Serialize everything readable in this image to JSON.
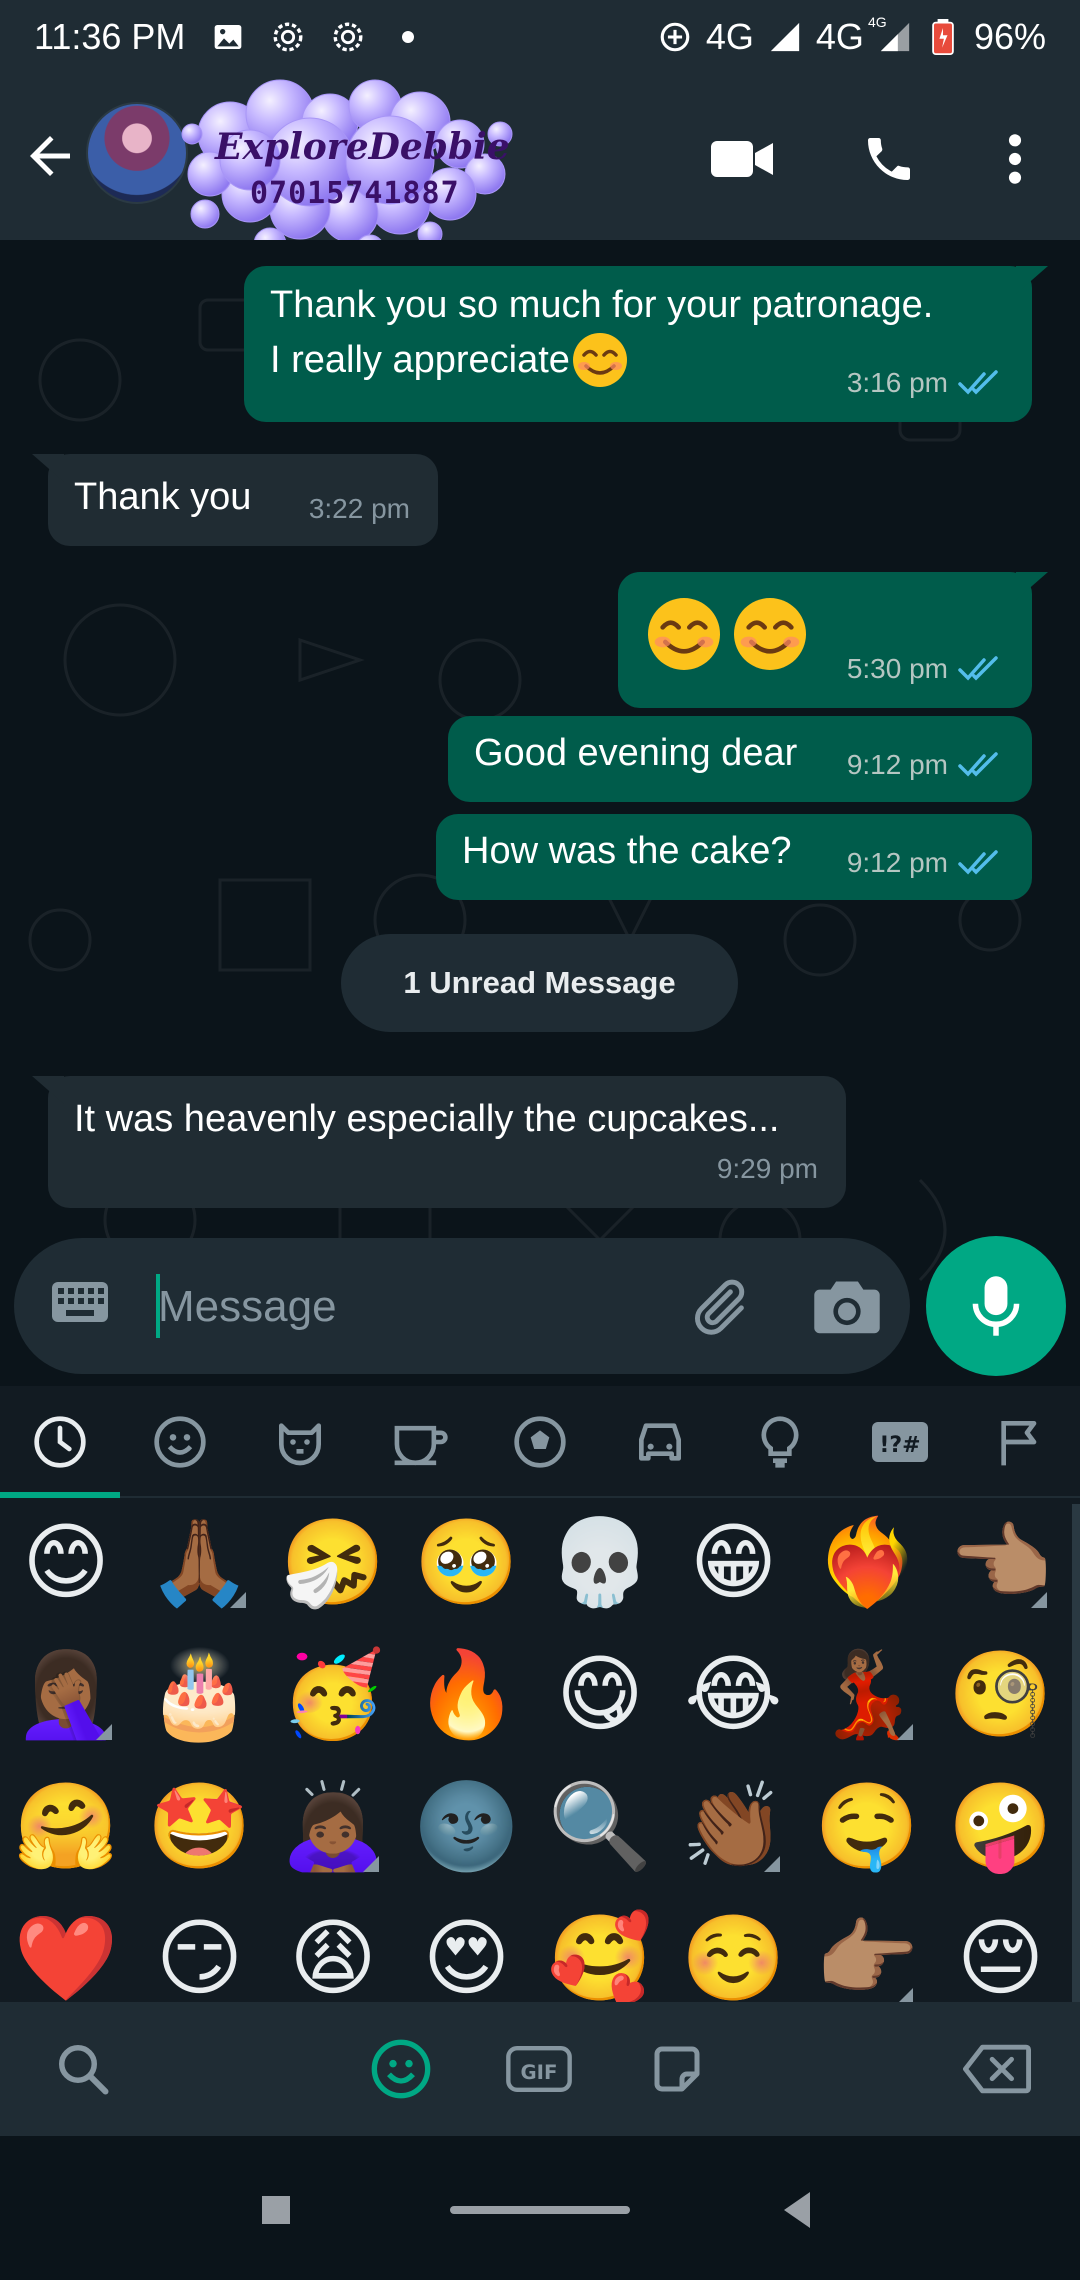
{
  "status_bar": {
    "time": "11:36 PM",
    "network_1": "4G",
    "network_2": "4G",
    "network_2_sup": "4G",
    "battery": "96%"
  },
  "header": {
    "contact_name": "ExploreDebbie",
    "contact_phone": "07015741887"
  },
  "messages": [
    {
      "direction": "out",
      "text_line1": "Thank you so much for your patronage.",
      "text_line2": "I really appreciate",
      "emoji": "smiling-face-with-smiling-eyes",
      "time": "3:16 pm",
      "status": "read"
    },
    {
      "direction": "in",
      "text": "Thank you",
      "time": "3:22 pm"
    },
    {
      "direction": "out",
      "emoji": [
        "smiling-face-with-smiling-eyes",
        "smiling-face-with-smiling-eyes"
      ],
      "time": "5:30 pm",
      "status": "read"
    },
    {
      "direction": "out",
      "text": "Good evening dear",
      "time": "9:12 pm",
      "status": "read"
    },
    {
      "direction": "out",
      "text": "How was the cake?",
      "time": "9:12 pm",
      "status": "read"
    },
    {
      "direction": "in",
      "text": "It was heavenly especially the cupcakes...",
      "time": "9:29 pm"
    }
  ],
  "unread_divider": "1 Unread Message",
  "composer": {
    "placeholder": "Message"
  },
  "emoji_categories": [
    "recent-icon",
    "smileys-icon",
    "animals-icon",
    "food-icon",
    "activity-icon",
    "travel-icon",
    "objects-icon",
    "symbols-icon",
    "flags-icon"
  ],
  "emoji_grid": [
    [
      "😊",
      "🙏🏾",
      "🤧",
      "🥹",
      "💀",
      "😁",
      "❤️‍🔥",
      "👈🏽"
    ],
    [
      "🤦🏾‍♀️",
      "🎂",
      "🥳",
      "🔥",
      "😋",
      "😂",
      "💃🏾",
      "🧐"
    ],
    [
      "🤗",
      "🤩",
      "🙇🏾‍♀️",
      "🌚",
      "🔍",
      "👏🏾",
      "🤤",
      "🤪"
    ],
    [
      "❤️",
      "😏",
      "😩",
      "😍",
      "🥰",
      "☺️",
      "👉🏽",
      "😔"
    ]
  ],
  "colors": {
    "accent": "#00a884",
    "outgoing_bubble": "#005c4b",
    "incoming_bubble": "#202c33",
    "header_bg": "#1f2c34",
    "chat_bg": "#0b141a",
    "read_ticks": "#53bdeb"
  }
}
